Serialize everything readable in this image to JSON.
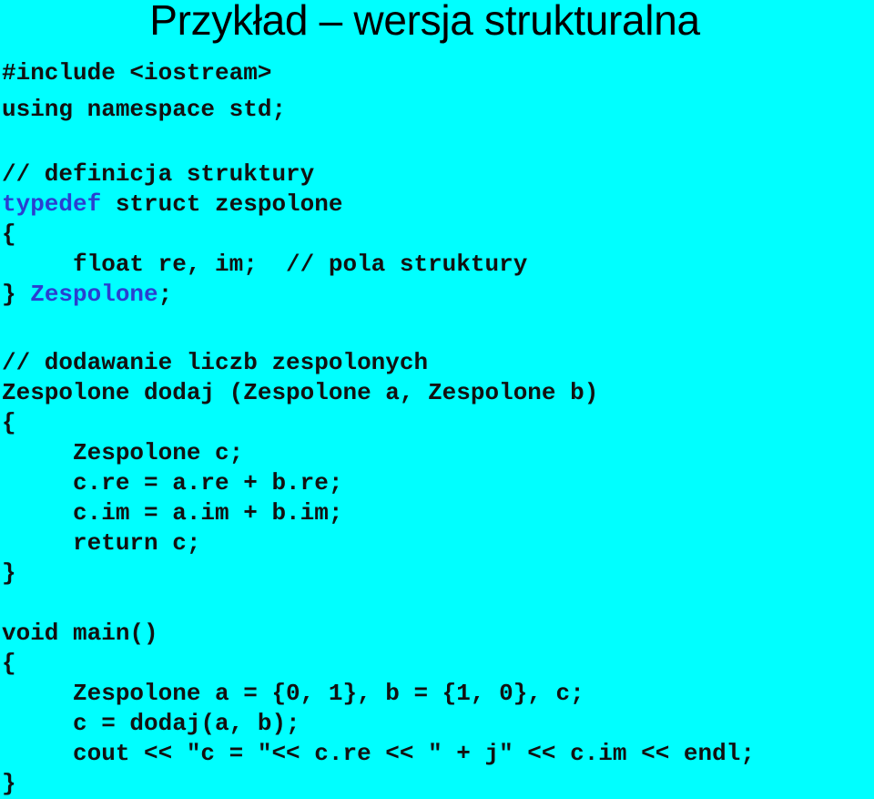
{
  "title": "Przykład – wersja strukturalna",
  "colors": {
    "background": "#00ffff",
    "keyword": "#2a3fd0",
    "text": "#111111"
  },
  "code": {
    "include": "#include <iostream>",
    "using": "using namespace std;",
    "comment_struct": "// definicja struktury",
    "typedef_kw": "typedef",
    "typedef_rest": " struct zespolone",
    "open1": "{",
    "fields": "     float re, im;  // pola struktury",
    "close1_brace": "} ",
    "close1_name": "Zespolone",
    "close1_semi": ";",
    "comment_add": "// dodawanie liczb zespolonych",
    "func_sig": "Zespolone dodaj (Zespolone a, Zespolone b)",
    "open2": "{",
    "decl_c": "     Zespolone c;",
    "assign_re": "     c.re = a.re + b.re;",
    "assign_im": "     c.im = a.im + b.im;",
    "ret": "     return c;",
    "close2": "}",
    "main_sig": "void main()",
    "open3": "{",
    "main_decl": "     Zespolone a = {0, 1}, b = {1, 0}, c;",
    "main_call": "     c = dodaj(a, b);",
    "main_cout": "     cout << \"c = \"<< c.re << \" + j\" << c.im << endl;",
    "close3": "}"
  }
}
